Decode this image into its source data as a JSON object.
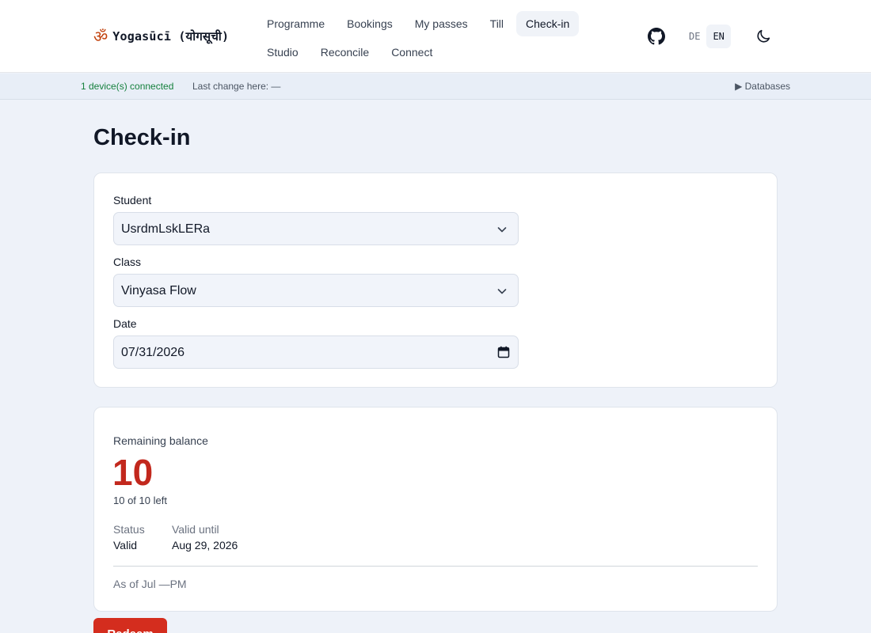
{
  "app": {
    "brand": "Yogasūcī (योगसूची)"
  },
  "nav": {
    "row1": [
      "Programme",
      "Bookings",
      "My passes",
      "Till",
      "Check-in"
    ],
    "row2": [
      "Studio",
      "Reconcile",
      "Connect"
    ],
    "active": "Check-in"
  },
  "lang": {
    "de": "DE",
    "en": "EN",
    "selected": "EN"
  },
  "icons": {
    "github": "github-icon",
    "theme": "moon-icon",
    "brand": "om-icon"
  },
  "status": {
    "connected": "1 device(s) connected",
    "last_change": "Last change here: —",
    "databases": "▶ Databases"
  },
  "page": {
    "title": "Check-in"
  },
  "form": {
    "student_label": "Student",
    "student_value": "UsrdmLskLERa",
    "class_label": "Class",
    "class_value": "Vinyasa Flow",
    "date_label": "Date",
    "date_value": "07/31/2026"
  },
  "balance": {
    "label": "Remaining balance",
    "value": "10",
    "left_text": "10 of 10 left",
    "status_label": "Status",
    "status_value": "Valid",
    "valid_until_label": "Valid until",
    "valid_until_value": "Aug 29, 2026",
    "as_of": "As of Jul —PM"
  },
  "actions": {
    "redeem": "Redeem"
  },
  "colors": {
    "accent": "#d42d1e",
    "connected": "#15803d"
  }
}
